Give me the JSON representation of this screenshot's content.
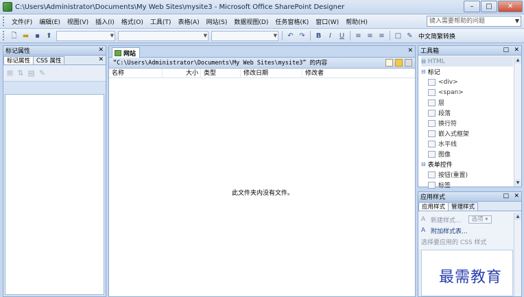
{
  "window": {
    "title": "C:\\Users\\Administrator\\Documents\\My Web Sites\\mysite3 - Microsoft Office SharePoint Designer",
    "buttons": {
      "minimize": "–",
      "maximize": "□",
      "close": "✕"
    }
  },
  "menu": {
    "items": [
      "文件(F)",
      "编辑(E)",
      "视图(V)",
      "插入(I)",
      "格式(O)",
      "工具(T)",
      "表格(A)",
      "网站(S)",
      "数据视图(D)",
      "任务窗格(K)",
      "窗口(W)",
      "帮助(H)"
    ],
    "help_placeholder": "键入需要帮助的问题"
  },
  "toolbar": {
    "chinese_convert": "中文简繁转换"
  },
  "left_panel": {
    "title": "标记属性",
    "tabs": [
      "标记属性",
      "CSS 属性"
    ]
  },
  "center": {
    "tab_label": "网站",
    "path": "“C:\\Users\\Administrator\\Documents\\My Web Sites\\mysite3” 的内容",
    "columns": [
      "名称",
      "大小",
      "类型",
      "修改日期",
      "修改者"
    ],
    "empty_message": "此文件夹内没有文件。"
  },
  "toolbox": {
    "title": "工具箱",
    "rows": [
      {
        "type": "category",
        "label": "HTML"
      },
      {
        "type": "category",
        "label": "标记"
      },
      {
        "type": "item",
        "label": "<div>"
      },
      {
        "type": "item",
        "label": "<span>"
      },
      {
        "type": "item",
        "label": "层"
      },
      {
        "type": "item",
        "label": "段落"
      },
      {
        "type": "item",
        "label": "换行符"
      },
      {
        "type": "item",
        "label": "嵌入式框架"
      },
      {
        "type": "item",
        "label": "水平线"
      },
      {
        "type": "item",
        "label": "图像"
      },
      {
        "type": "category",
        "label": "表单控件"
      },
      {
        "type": "item",
        "label": "按钮(重置)"
      },
      {
        "type": "item",
        "label": "标签"
      }
    ]
  },
  "styles_panel": {
    "title": "应用样式",
    "tabs": [
      "应用样式",
      "管理样式"
    ],
    "new_style": "新建样式...",
    "options": "选项",
    "attach": "附加样式表...",
    "select_css": "选择要应用的 CSS 样式"
  },
  "watermark": "最需教育",
  "colors": {
    "accent": "#c5d7ef",
    "watermark": "#2b3fae"
  }
}
